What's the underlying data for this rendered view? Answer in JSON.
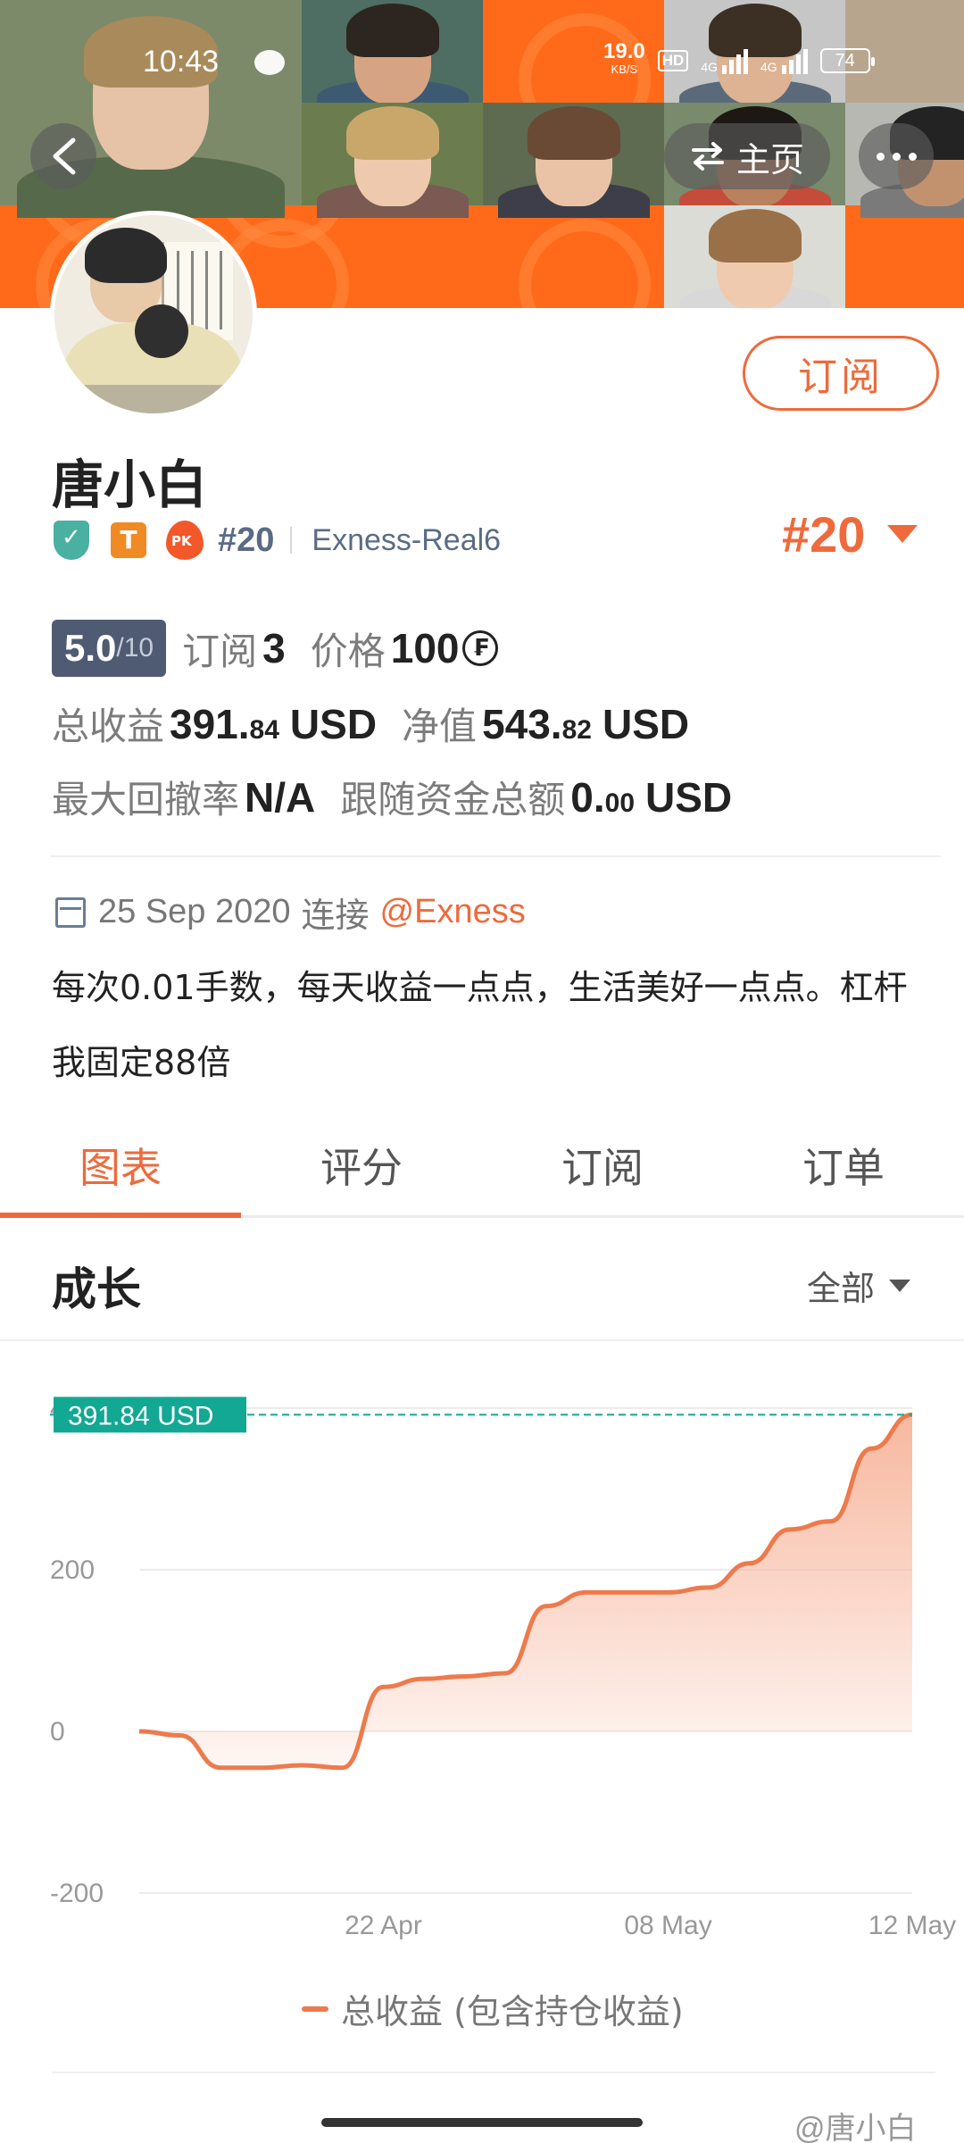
{
  "status_bar": {
    "time": "10:43",
    "network_speed": "19.0",
    "network_unit": "KB/S",
    "hd": "HD",
    "net_label_1": "4G",
    "net_label_2": "4G",
    "battery": "74"
  },
  "nav": {
    "back_icon": "chevron-left-icon",
    "home_label": "主页",
    "home_icon": "swap-icon",
    "more_icon": "more-dots-icon"
  },
  "profile": {
    "name": "唐小白",
    "subscribe_label": "订阅",
    "badge_t": "T",
    "badge_pk": "PK",
    "rank_small": "#20",
    "server": "Exness-Real6",
    "rank_big": "#20"
  },
  "stats": {
    "score": "5.0",
    "score_max": "/10",
    "subscriptions_label": "订阅",
    "subscriptions_value": "3",
    "price_label": "价格",
    "price_value": "100",
    "coin_icon": "₣",
    "total_profit_label": "总收益",
    "total_profit_int": "391.",
    "total_profit_dec": "84",
    "total_profit_unit": "USD",
    "equity_label": "净值",
    "equity_int": "543.",
    "equity_dec": "82",
    "equity_unit": "USD",
    "max_drawdown_label": "最大回撤率",
    "max_drawdown_value": "N/A",
    "follow_funds_label": "跟随资金总额",
    "follow_funds_int": "0.",
    "follow_funds_dec": "00",
    "follow_funds_unit": "USD"
  },
  "meta": {
    "date": "25 Sep 2020",
    "connect_label": "连接",
    "broker_link": "@Exness",
    "description": "每次0.01手数，每天收益一点点，生活美好一点点。杠杆我固定88倍"
  },
  "tabs": [
    {
      "label": "图表",
      "active": true
    },
    {
      "label": "评分",
      "active": false
    },
    {
      "label": "订阅",
      "active": false
    },
    {
      "label": "订单",
      "active": false
    }
  ],
  "growth": {
    "title": "成长",
    "range_label": "全部"
  },
  "chart_data": {
    "type": "area",
    "series": [
      {
        "name": "总收益 (包含持仓收益)",
        "x": [
          "",
          "",
          "",
          "",
          "",
          "",
          "22 Apr",
          "",
          "",
          "",
          "",
          "",
          "",
          "08 May",
          "",
          "",
          "",
          "",
          "",
          "12 May"
        ],
        "values": [
          0,
          -5,
          -45,
          -45,
          -42,
          -45,
          55,
          65,
          68,
          72,
          155,
          172,
          172,
          172,
          178,
          208,
          250,
          260,
          350,
          391.84
        ]
      }
    ],
    "current_value_label": "391.84 USD",
    "yticks": [
      "-200",
      "0",
      "200",
      "400"
    ],
    "xticks": [
      "22 Apr",
      "08 May",
      "12 May"
    ],
    "ylim": [
      -200,
      400
    ],
    "colors": {
      "line": "#ee7a4c",
      "fill": "#f7b49a",
      "marker": "#13a893"
    }
  },
  "footer": {
    "watermark": "@唐小白"
  }
}
